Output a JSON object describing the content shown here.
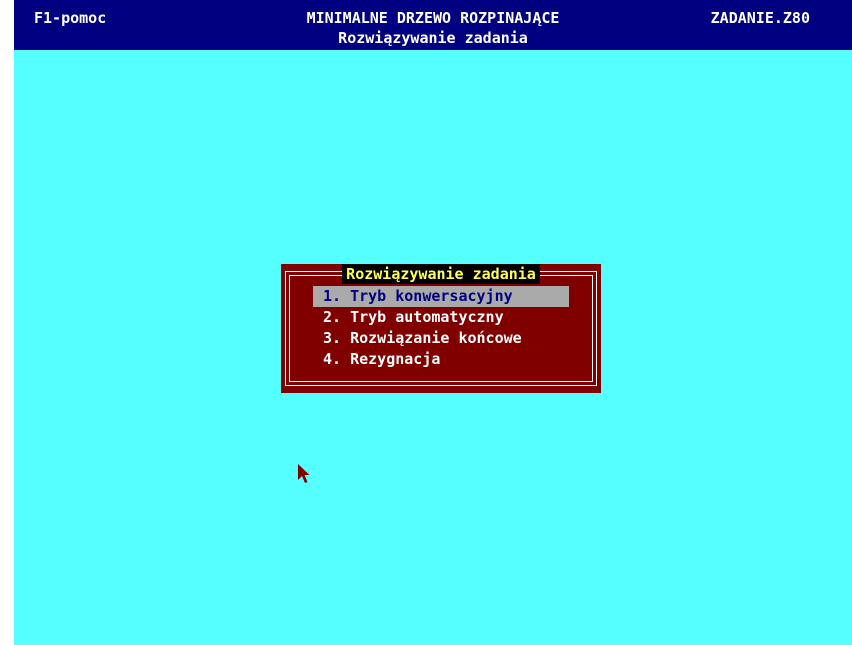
{
  "header": {
    "help_label": "F1-pomoc",
    "title": "MINIMALNE DRZEWO ROZPINAJĄCE",
    "subtitle": "Rozwiązywanie zadania",
    "task_id": "ZADANIE.Z80"
  },
  "menu": {
    "title": "Rozwiązywanie zadania",
    "selected_index": 0,
    "items": [
      {
        "label": "1. Tryb konwersacyjny"
      },
      {
        "label": "2. Tryb automatyczny"
      },
      {
        "label": "3. Rozwiązanie końcowe"
      },
      {
        "label": "4. Rezygnacja"
      }
    ]
  },
  "colors": {
    "background": "#55ffff",
    "header_bg": "#000080",
    "menu_bg": "#800000",
    "menu_title": "#ffff55",
    "selection": "#aaaaaa",
    "cursor": "#800000"
  },
  "icons": {
    "mouse_cursor": "arrow-pointer-icon"
  }
}
